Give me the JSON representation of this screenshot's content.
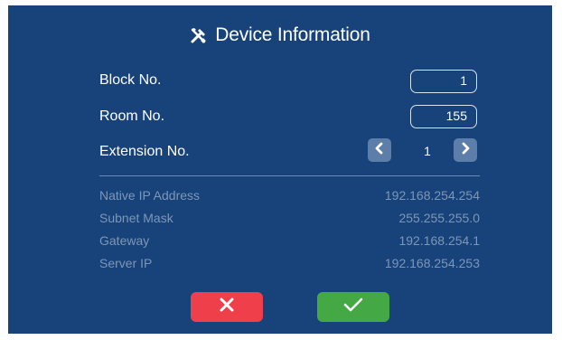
{
  "title": "Device Information",
  "title_icon": "tools-icon",
  "fields": {
    "block": {
      "label": "Block No.",
      "value": "1"
    },
    "room": {
      "label": "Room No.",
      "value": "155"
    },
    "extension": {
      "label": "Extension No.",
      "value": "1"
    }
  },
  "network": [
    {
      "label": "Native IP Address",
      "value": "192.168.254.254"
    },
    {
      "label": "Subnet Mask",
      "value": "255.255.255.0"
    },
    {
      "label": "Gateway",
      "value": "192.168.254.1"
    },
    {
      "label": "Server IP",
      "value": "192.168.254.253"
    }
  ],
  "buttons": {
    "cancel_icon": "close-icon",
    "confirm_icon": "check-icon"
  },
  "colors": {
    "background": "#17427a",
    "cancel": "#ef3f4a",
    "confirm": "#44a845",
    "muted_text": "#7d97b7",
    "arrow_button": "#5d7ea8"
  }
}
